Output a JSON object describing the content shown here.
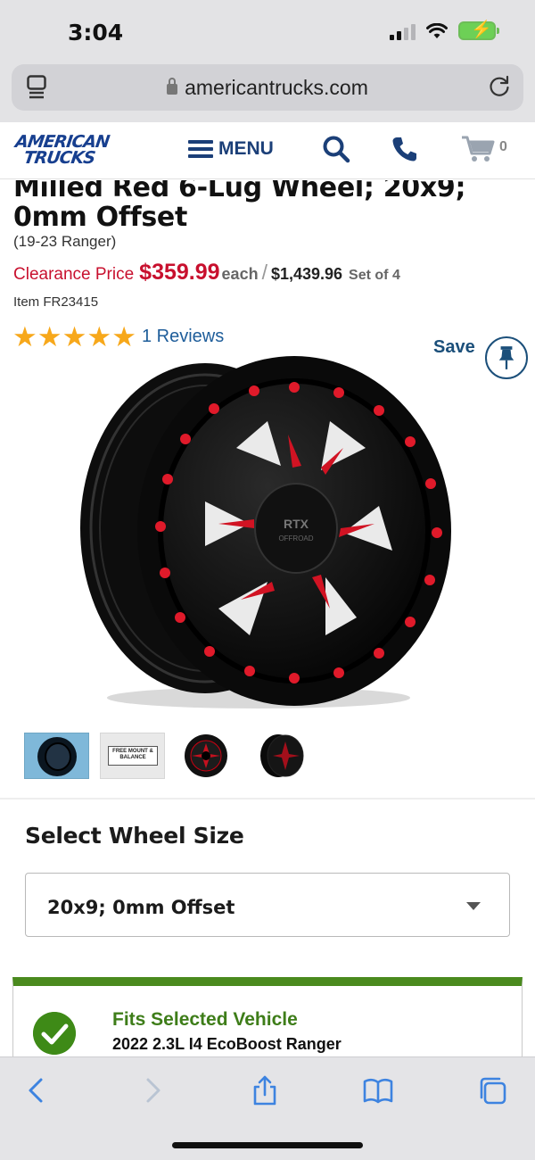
{
  "status_bar": {
    "time": "3:04"
  },
  "browser": {
    "url": "americantrucks.com"
  },
  "header": {
    "logo_line1": "AMERICAN",
    "logo_line2": "TRUCKS",
    "menu_label": "MENU",
    "cart_count": "0"
  },
  "product": {
    "title": "Milled Red 6-Lug Wheel; 20x9; 0mm Offset",
    "fitment": "(19-23 Ranger)",
    "clearance_label": "Clearance Price",
    "price": "$359.99",
    "each_label": "each",
    "divider": "/",
    "set_price": "$1,439.96",
    "set_label": "Set of 4",
    "item_number": "Item FR23415",
    "rating": 5,
    "reviews_text": "1 Reviews",
    "save_label": "Save",
    "wheel_logo_text": "RTX",
    "wheel_logo_sub": "OFFROAD"
  },
  "thumbnails": [
    {
      "label": ""
    },
    {
      "label": "FREE MOUNT & BALANCE"
    },
    {
      "label": ""
    },
    {
      "label": ""
    }
  ],
  "wheel_size": {
    "label": "Select Wheel Size",
    "selected": "20x9; 0mm Offset"
  },
  "fitment_box": {
    "title": "Fits Selected Vehicle",
    "vehicle": "2022 2.3L I4 EcoBoost Ranger"
  },
  "colors": {
    "brand_blue": "#173f8f",
    "clearance_red": "#c8102e",
    "star": "#f7a81b",
    "fit_green": "#4a8a1e",
    "link_blue": "#1e5d9a"
  }
}
